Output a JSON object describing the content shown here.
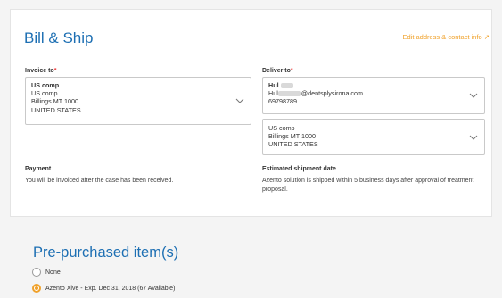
{
  "bill_ship": {
    "title": "Bill & Ship",
    "edit_link": "Edit address & contact info",
    "edit_link_icon": "arrow-up-right-icon",
    "invoice": {
      "label": "Invoice to",
      "required_mark": "*",
      "lines": [
        "US comp",
        "US comp",
        "Billings MT 1000",
        "UNITED STATES"
      ]
    },
    "deliver": {
      "label": "Deliver to",
      "required_mark": "*",
      "contact": {
        "name": "Hul",
        "email_prefix": "Hul",
        "email_suffix": "dentsplysirona.com",
        "phone": "69798789"
      },
      "address_lines": [
        "US comp",
        "Billings MT 1000",
        "UNITED STATES"
      ]
    },
    "payment": {
      "heading": "Payment",
      "text": "You will be invoiced after the case has been received."
    },
    "shipment": {
      "heading": "Estimated shipment date",
      "text": "Azento solution is shipped within 5 business days after approval of treatment proposal."
    }
  },
  "pre_purchased": {
    "title": "Pre-purchased item(s)",
    "options": [
      {
        "label": "None",
        "selected": false
      },
      {
        "label": "Azento Xive - Exp. Dec 31, 2018 (67 Available)",
        "selected": true
      }
    ]
  },
  "colors": {
    "accent_blue": "#1d6fb3",
    "accent_orange": "#f0a12a",
    "required_red": "#e33"
  }
}
